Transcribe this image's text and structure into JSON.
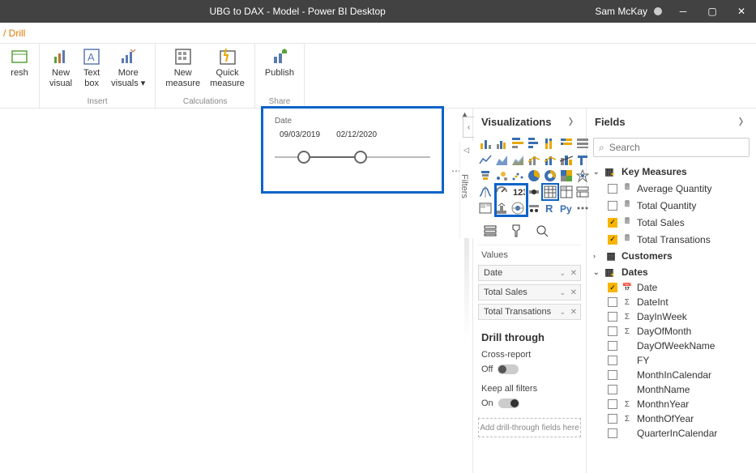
{
  "titlebar": {
    "title": "UBG to DAX - Model - Power BI Desktop",
    "user": "Sam McKay"
  },
  "tabrow": {
    "crumb": "/ Drill"
  },
  "ribbon": {
    "groups": [
      {
        "label": "",
        "items": [
          {
            "name": "refresh",
            "l1": "resh",
            "l2": ""
          }
        ]
      },
      {
        "label": "Insert",
        "items": [
          {
            "name": "new-visual",
            "l1": "New",
            "l2": "visual"
          },
          {
            "name": "text-box",
            "l1": "Text",
            "l2": "box"
          },
          {
            "name": "more-visuals",
            "l1": "More",
            "l2": "visuals ▾"
          }
        ]
      },
      {
        "label": "Calculations",
        "items": [
          {
            "name": "new-measure",
            "l1": "New",
            "l2": "measure"
          },
          {
            "name": "quick-measure",
            "l1": "Quick",
            "l2": "measure"
          }
        ]
      },
      {
        "label": "Share",
        "items": [
          {
            "name": "publish",
            "l1": "Publish",
            "l2": ""
          }
        ]
      }
    ]
  },
  "slicer": {
    "title": "Date",
    "start": "09/03/2019",
    "end": "02/12/2020"
  },
  "vizpane": {
    "title": "Visualizations",
    "values_label": "Values",
    "wells": [
      "Date",
      "Total Sales",
      "Total Transations"
    ],
    "drill_title": "Drill through",
    "cross_label": "Cross-report",
    "cross_state": "Off",
    "keep_label": "Keep all filters",
    "keep_state": "On",
    "drill_well": "Add drill-through fields here"
  },
  "fieldspane": {
    "title": "Fields",
    "search_ph": "Search",
    "groups": [
      {
        "name": "Key Measures",
        "open": true,
        "icon": "measure",
        "items": [
          {
            "label": "Average Quantity",
            "checked": false,
            "icon": "calc"
          },
          {
            "label": "Total Quantity",
            "checked": false,
            "icon": "calc"
          },
          {
            "label": "Total Sales",
            "checked": true,
            "icon": "calc"
          },
          {
            "label": "Total Transations",
            "checked": true,
            "icon": "calc"
          }
        ]
      },
      {
        "name": "Customers",
        "open": false,
        "icon": "table",
        "items": []
      },
      {
        "name": "Dates",
        "open": true,
        "icon": "table-m",
        "items": [
          {
            "label": "Date",
            "checked": true,
            "icon": "cal"
          },
          {
            "label": "DateInt",
            "checked": false,
            "icon": "sigma"
          },
          {
            "label": "DayInWeek",
            "checked": false,
            "icon": "sigma"
          },
          {
            "label": "DayOfMonth",
            "checked": false,
            "icon": "sigma"
          },
          {
            "label": "DayOfWeekName",
            "checked": false,
            "icon": ""
          },
          {
            "label": "FY",
            "checked": false,
            "icon": ""
          },
          {
            "label": "MonthInCalendar",
            "checked": false,
            "icon": ""
          },
          {
            "label": "MonthName",
            "checked": false,
            "icon": ""
          },
          {
            "label": "MonthnYear",
            "checked": false,
            "icon": "sigma"
          },
          {
            "label": "MonthOfYear",
            "checked": false,
            "icon": "sigma"
          },
          {
            "label": "QuarterInCalendar",
            "checked": false,
            "icon": ""
          }
        ]
      }
    ]
  }
}
